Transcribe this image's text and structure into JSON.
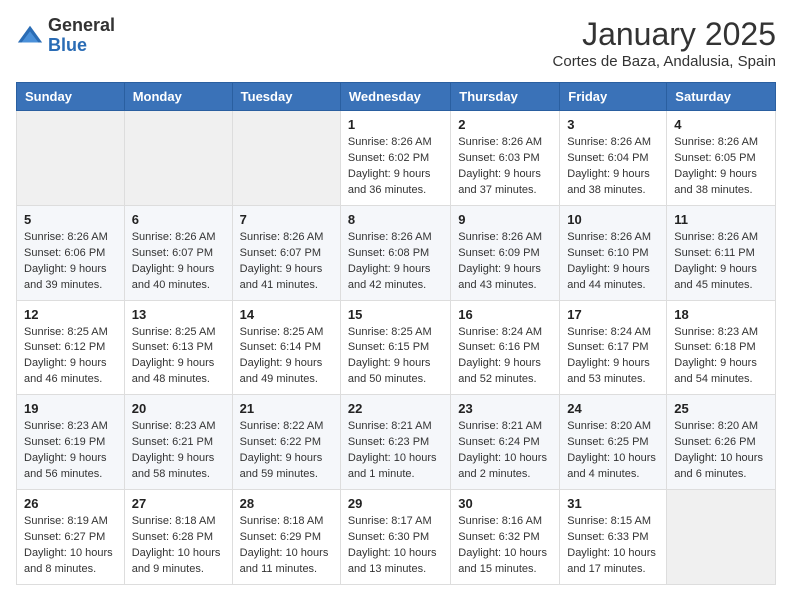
{
  "header": {
    "logo_general": "General",
    "logo_blue": "Blue",
    "month_year": "January 2025",
    "location": "Cortes de Baza, Andalusia, Spain"
  },
  "weekdays": [
    "Sunday",
    "Monday",
    "Tuesday",
    "Wednesday",
    "Thursday",
    "Friday",
    "Saturday"
  ],
  "weeks": [
    [
      {
        "day": "",
        "content": ""
      },
      {
        "day": "",
        "content": ""
      },
      {
        "day": "",
        "content": ""
      },
      {
        "day": "1",
        "content": "Sunrise: 8:26 AM\nSunset: 6:02 PM\nDaylight: 9 hours\nand 36 minutes."
      },
      {
        "day": "2",
        "content": "Sunrise: 8:26 AM\nSunset: 6:03 PM\nDaylight: 9 hours\nand 37 minutes."
      },
      {
        "day": "3",
        "content": "Sunrise: 8:26 AM\nSunset: 6:04 PM\nDaylight: 9 hours\nand 38 minutes."
      },
      {
        "day": "4",
        "content": "Sunrise: 8:26 AM\nSunset: 6:05 PM\nDaylight: 9 hours\nand 38 minutes."
      }
    ],
    [
      {
        "day": "5",
        "content": "Sunrise: 8:26 AM\nSunset: 6:06 PM\nDaylight: 9 hours\nand 39 minutes."
      },
      {
        "day": "6",
        "content": "Sunrise: 8:26 AM\nSunset: 6:07 PM\nDaylight: 9 hours\nand 40 minutes."
      },
      {
        "day": "7",
        "content": "Sunrise: 8:26 AM\nSunset: 6:07 PM\nDaylight: 9 hours\nand 41 minutes."
      },
      {
        "day": "8",
        "content": "Sunrise: 8:26 AM\nSunset: 6:08 PM\nDaylight: 9 hours\nand 42 minutes."
      },
      {
        "day": "9",
        "content": "Sunrise: 8:26 AM\nSunset: 6:09 PM\nDaylight: 9 hours\nand 43 minutes."
      },
      {
        "day": "10",
        "content": "Sunrise: 8:26 AM\nSunset: 6:10 PM\nDaylight: 9 hours\nand 44 minutes."
      },
      {
        "day": "11",
        "content": "Sunrise: 8:26 AM\nSunset: 6:11 PM\nDaylight: 9 hours\nand 45 minutes."
      }
    ],
    [
      {
        "day": "12",
        "content": "Sunrise: 8:25 AM\nSunset: 6:12 PM\nDaylight: 9 hours\nand 46 minutes."
      },
      {
        "day": "13",
        "content": "Sunrise: 8:25 AM\nSunset: 6:13 PM\nDaylight: 9 hours\nand 48 minutes."
      },
      {
        "day": "14",
        "content": "Sunrise: 8:25 AM\nSunset: 6:14 PM\nDaylight: 9 hours\nand 49 minutes."
      },
      {
        "day": "15",
        "content": "Sunrise: 8:25 AM\nSunset: 6:15 PM\nDaylight: 9 hours\nand 50 minutes."
      },
      {
        "day": "16",
        "content": "Sunrise: 8:24 AM\nSunset: 6:16 PM\nDaylight: 9 hours\nand 52 minutes."
      },
      {
        "day": "17",
        "content": "Sunrise: 8:24 AM\nSunset: 6:17 PM\nDaylight: 9 hours\nand 53 minutes."
      },
      {
        "day": "18",
        "content": "Sunrise: 8:23 AM\nSunset: 6:18 PM\nDaylight: 9 hours\nand 54 minutes."
      }
    ],
    [
      {
        "day": "19",
        "content": "Sunrise: 8:23 AM\nSunset: 6:19 PM\nDaylight: 9 hours\nand 56 minutes."
      },
      {
        "day": "20",
        "content": "Sunrise: 8:23 AM\nSunset: 6:21 PM\nDaylight: 9 hours\nand 58 minutes."
      },
      {
        "day": "21",
        "content": "Sunrise: 8:22 AM\nSunset: 6:22 PM\nDaylight: 9 hours\nand 59 minutes."
      },
      {
        "day": "22",
        "content": "Sunrise: 8:21 AM\nSunset: 6:23 PM\nDaylight: 10 hours\nand 1 minute."
      },
      {
        "day": "23",
        "content": "Sunrise: 8:21 AM\nSunset: 6:24 PM\nDaylight: 10 hours\nand 2 minutes."
      },
      {
        "day": "24",
        "content": "Sunrise: 8:20 AM\nSunset: 6:25 PM\nDaylight: 10 hours\nand 4 minutes."
      },
      {
        "day": "25",
        "content": "Sunrise: 8:20 AM\nSunset: 6:26 PM\nDaylight: 10 hours\nand 6 minutes."
      }
    ],
    [
      {
        "day": "26",
        "content": "Sunrise: 8:19 AM\nSunset: 6:27 PM\nDaylight: 10 hours\nand 8 minutes."
      },
      {
        "day": "27",
        "content": "Sunrise: 8:18 AM\nSunset: 6:28 PM\nDaylight: 10 hours\nand 9 minutes."
      },
      {
        "day": "28",
        "content": "Sunrise: 8:18 AM\nSunset: 6:29 PM\nDaylight: 10 hours\nand 11 minutes."
      },
      {
        "day": "29",
        "content": "Sunrise: 8:17 AM\nSunset: 6:30 PM\nDaylight: 10 hours\nand 13 minutes."
      },
      {
        "day": "30",
        "content": "Sunrise: 8:16 AM\nSunset: 6:32 PM\nDaylight: 10 hours\nand 15 minutes."
      },
      {
        "day": "31",
        "content": "Sunrise: 8:15 AM\nSunset: 6:33 PM\nDaylight: 10 hours\nand 17 minutes."
      },
      {
        "day": "",
        "content": ""
      }
    ]
  ]
}
